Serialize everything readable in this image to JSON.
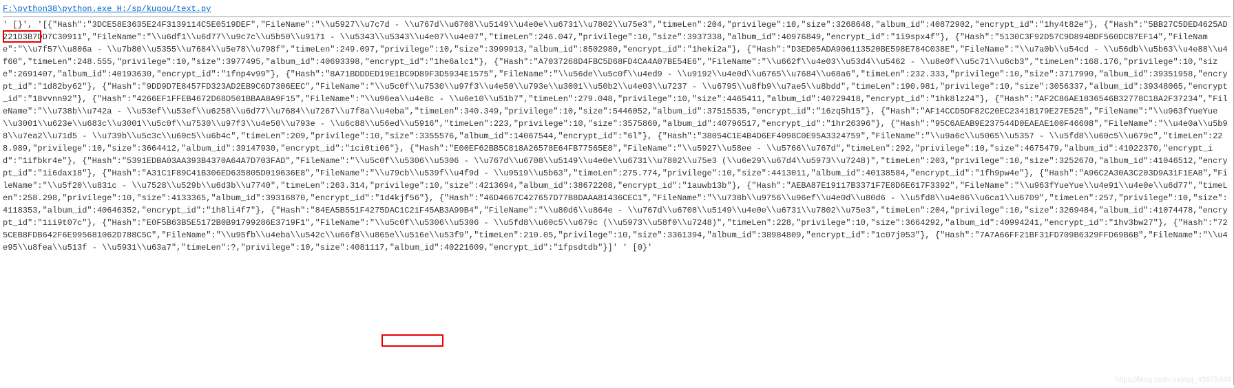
{
  "command_prefix": "F:\\python38\\python.exe H:/sp/kugou/text.py",
  "start_marker": "' [}', '",
  "end_marker": " ' [0}'",
  "watermark": "https://blog.csdn.net/qq_45675449",
  "console_text": "[{\"Hash\":\"3DCE58E3635E24F3139114C5E0519DEF\",\"FileName\":\"\\\\u5927\\\\u7c7d - \\\\u767d\\\\u6708\\\\u5149\\\\u4e0e\\\\u6731\\\\u7802\\\\u75e3\",\"timeLen\":204,\"privilege\":10,\"size\":3268648,\"album_id\":40872902,\"encrypt_id\":\"1hy4t82e\"}, {\"Hash\":\"5BB27C5DED4625AD221D3B7DD7C30911\",\"FileName\":\"\\\\u6df1\\\\u6d77\\\\u9c7c\\\\u5b50\\\\u9171 - \\\\u5343\\\\u5343\\\\u4e07\\\\u4e07\",\"timeLen\":246.047,\"privilege\":10,\"size\":3937338,\"album_id\":40976849,\"encrypt_id\":\"1i9spx4f\"}, {\"Hash\":\"5130C3F92D57C9D894BDF560DC87EF14\",\"FileName\":\"\\\\u7f57\\\\u806a - \\\\u7b80\\\\u5355\\\\u7684\\\\u5e78\\\\u798f\",\"timeLen\":249.097,\"privilege\":10,\"size\":3999913,\"album_id\":8502980,\"encrypt_id\":\"1heki2a\"}, {\"Hash\":\"D3ED05ADA906113520BE598E784C038E\",\"FileName\":\"\\\\u7a0b\\\\u54cd - \\\\u56db\\\\u5b63\\\\u4e88\\\\u4f60\",\"timeLen\":248.555,\"privilege\":10,\"size\":3977495,\"album_id\":40693398,\"encrypt_id\":\"1he6alc1\"}, {\"Hash\":\"A7037268D4FBC5D68FD4CA4A07BE54E6\",\"FileName\":\"\\\\u662f\\\\u4e03\\\\u53d4\\\\u5462 - \\\\u8e0f\\\\u5c71\\\\u6cb3\",\"timeLen\":168.176,\"privilege\":10,\"size\":2691407,\"album_id\":40193630,\"encrypt_id\":\"1fnp4v99\"}, {\"Hash\":\"8A71BDDDED19E1BC9D89F3D5934E1575\",\"FileName\":\"\\\\u56de\\\\u5c0f\\\\u4ed9 - \\\\u9192\\\\u4e0d\\\\u6765\\\\u7684\\\\u68a6\",\"timeLen\":232.333,\"privilege\":10,\"size\":3717990,\"album_id\":39351958,\"encrypt_id\":\"1d82by62\"}, {\"Hash\":\"9DD9D7E8457FD323AD2EB9C6D7306EEC\",\"FileName\":\"\\\\u5c0f\\\\u7530\\\\u97f3\\\\u4e50\\\\u793e\\\\u3001\\\\u50b2\\\\u4e03\\\\u7237 - \\\\u6795\\\\u8fb9\\\\u7ae5\\\\u8bdd\",\"timeLen\":190.981,\"privilege\":10,\"size\":3056337,\"album_id\":39348065,\"encrypt_id\":\"18vvnn92\"}, {\"Hash\":\"4266EF1FFEB4672D68D501BBAA8A9F15\",\"FileName\":\"\\\\u96ea\\\\u4e8c - \\\\u6e10\\\\u51b7\",\"timeLen\":279.048,\"privilege\":10,\"size\":4465411,\"album_id\":40729418,\"encrypt_id\":\"1hk8lz24\"}, {\"Hash\":\"AF2C86AE1836546B32778C18A2F37234\",\"FileName\":\"\\\\u738b\\\\u742a - \\\\u53ef\\\\u53ef\\\\u6258\\\\u6d77\\\\u7684\\\\u7267\\\\u7f8a\\\\u4eba\",\"timeLen\":340.349,\"privilege\":10,\"size\":5446052,\"album_id\":37515535,\"encrypt_id\":\"16zq5h15\"}, {\"Hash\":\"AF14CCD5DF82C20EC23418179E27E525\",\"FileName\":\"\\\\u963fYueYue\\\\u3001\\\\u623e\\\\u683c\\\\u3001\\\\u5c0f\\\\u7530\\\\u97f3\\\\u4e50\\\\u793e - \\\\u6c88\\\\u56ed\\\\u5916\",\"timeLen\":223,\"privilege\":10,\"size\":3575860,\"album_id\":40796517,\"encrypt_id\":\"1hr26396\"}, {\"Hash\":\"95C6AEAB9E237544D0EAEAE100F46608\",\"FileName\":\"\\\\u4e0a\\\\u5b98\\\\u7ea2\\\\u71d5 - \\\\u739b\\\\u5c3c\\\\u60c5\\\\u6b4c\",\"timeLen\":209,\"privilege\":10,\"size\":3355576,\"album_id\":14067544,\"encrypt_id\":\"6l\"}, {\"Hash\":\"38054C1E4B4D6EF4098C0E95A3324759\",\"FileName\":\"\\\\u9a6c\\\\u5065\\\\u5357 - \\\\u5fd8\\\\u60c5\\\\u679c\",\"timeLen\":228.989,\"privilege\":10,\"size\":3664412,\"album_id\":39147930,\"encrypt_id\":\"1ci0ti06\"}, {\"Hash\":\"E00EF62BB5C818A26578E64FB77565E8\",\"FileName\":\"\\\\u5927\\\\u58ee - \\\\u5766\\\\u767d\",\"timeLen\":292,\"privilege\":10,\"size\":4675479,\"album_id\":41022370,\"encrypt_id\":\"1ifbkr4e\"}, {\"Hash\":\"5391EDBA03AA393B4370A64A7D703FAD\",\"FileName\":\"\\\\u5c0f\\\\u5306\\\\u5306 - \\\\u767d\\\\u6708\\\\u5149\\\\u4e0e\\\\u6731\\\\u7802\\\\u75e3 (\\\\u6e29\\\\u67d4\\\\u5973\\\\u7248)\",\"timeLen\":203,\"privilege\":10,\"size\":3252670,\"album_id\":41046512,\"encrypt_id\":\"1i6dax18\"}, {\"Hash\":\"A31C1F89C41B306ED635805D019636E8\",\"FileName\":\"\\\\u79cb\\\\u539f\\\\u4f9d - \\\\u9519\\\\u5b63\",\"timeLen\":275.774,\"privilege\":10,\"size\":4413011,\"album_id\":40138584,\"encrypt_id\":\"1fh9pw4e\"}, {\"Hash\":\"A96C2A30A3C203D9A31F1EA8\",\"FileName\":\"\\\\u5f20\\\\u831c - \\\\u7528\\\\u529b\\\\u6d3b\\\\u7740\",\"timeLen\":263.314,\"privilege\":10,\"size\":4213694,\"album_id\":38672208,\"encrypt_id\":\"1auwb13b\"}, {\"Hash\":\"AEBA87E19117B3371F7E8D6E617F3392\",\"FileName\":\"\\\\u963fYueYue\\\\u4e91\\\\u4e0e\\\\u6d77\",\"timeLen\":258.298,\"privilege\":10,\"size\":4133365,\"album_id\":39316870,\"encrypt_id\":\"1d4kjf56\"}, {\"Hash\":\"46D4667C427657D77B8DAAA81436CEC1\",\"FileName\":\"\\\\u738b\\\\u9756\\\\u96ef\\\\u4e0d\\\\u80d6 - \\\\u5fd8\\\\u4e86\\\\u6ca1\\\\u6709\",\"timeLen\":257,\"privilege\":10,\"size\":4118353,\"album_id\":40646352,\"encrypt_id\":\"1h8li4f7\"}, {\"Hash\":\"84EA5B551F4275DAC1C21F45AB3A99B4\",\"FileName\":\"\\\\u80d6\\\\u864e - \\\\u767d\\\\u6708\\\\u5149\\\\u4e0e\\\\u6731\\\\u7802\\\\u75e3\",\"timeLen\":204,\"privilege\":10,\"size\":3269484,\"album_id\":41074478,\"encrypt_id\":\"1ii9t07c\"}, {\"Hash\":\"E0F5B63B5E5172B0B91799286E3719F1\",\"FileName\":\"\\\\u5c0f\\\\u5306\\\\u5306 - \\\\u5fd8\\\\u60c5\\\\u679c (\\\\u5973\\\\u58f0\\\\u7248)\",\"timeLen\":228,\"privilege\":10,\"size\":3664292,\"album_id\":40994241,\"encrypt_id\":\"1hv3bw27\"}, {\"Hash\":\"725CEB8FDB642F6E995681062D788C5C\",\"FileName\":\"\\\\u95fb\\\\u4eba\\\\u542c\\\\u66f8\\\\u865e\\\\u516e\\\\u53f9\",\"timeLen\":210.05,\"privilege\":10,\"size\":3361394,\"album_id\":38984809,\"encrypt_id\":\"1c07j053\"}, {\"Hash\":\"7A7A66FF21BF31FD709B6329FFD69B6B\",\"FileName\":\"\\\\u4e95\\\\u8fea\\\\u513f - \\\\u5931\\\\u63a7\",\"timeLen\":?,\"privilege\":10,\"size\":4081117,\"album_id\":40221609,\"encrypt_id\":\"1fpsdtdb\"}]'"
}
